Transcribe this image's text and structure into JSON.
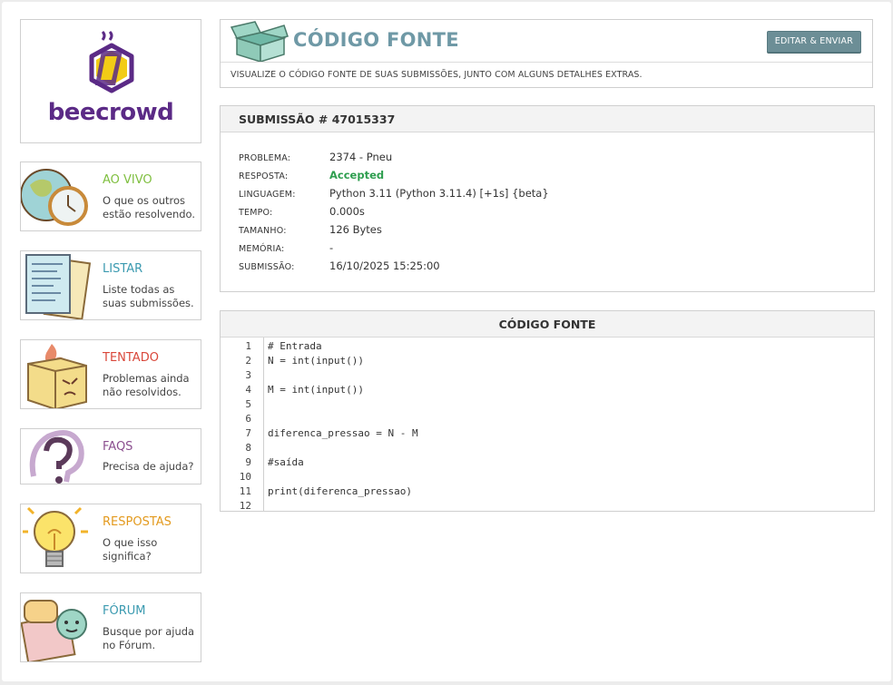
{
  "sidebar": {
    "logo_text": "beecrowd",
    "cards": [
      {
        "title": "AO VIVO",
        "desc": "O que os outros estão resolvendo.",
        "color": "#7fbf3f",
        "icon": "globe-clock-icon"
      },
      {
        "title": "LISTAR",
        "desc": "Liste todas as suas submissões.",
        "color": "#3b9ab0",
        "icon": "papers-icon"
      },
      {
        "title": "TENTADO",
        "desc": "Problemas ainda não resolvidos.",
        "color": "#d9473a",
        "icon": "angry-box-icon"
      },
      {
        "title": "FAQS",
        "desc": "Precisa de ajuda?",
        "color": "#8b4f8f",
        "icon": "question-mark-icon"
      },
      {
        "title": "RESPOSTAS",
        "desc": "O que isso significa?",
        "color": "#e39a1e",
        "icon": "lightbulb-icon"
      },
      {
        "title": "FÓRUM",
        "desc": "Busque por ajuda no Fórum.",
        "color": "#3b9ab0",
        "icon": "speech-bubbles-icon"
      }
    ]
  },
  "header": {
    "title": "CÓDIGO FONTE",
    "edit_button": "EDITAR & ENVIAR",
    "subtitle": "VISUALIZE O CÓDIGO FONTE DE SUAS SUBMISSÕES, JUNTO COM ALGUNS DETALHES EXTRAS.",
    "icon": "open-box-icon"
  },
  "submission": {
    "heading": "SUBMISSÃO # 47015337",
    "fields": [
      {
        "key": "PROBLEMA:",
        "value": "2374 - Pneu"
      },
      {
        "key": "RESPOSTA:",
        "value": "Accepted"
      },
      {
        "key": "LINGUAGEM:",
        "value": "Python 3.11 (Python 3.11.4) [+1s] {beta}"
      },
      {
        "key": "TEMPO:",
        "value": "0.000s"
      },
      {
        "key": "TAMANHO:",
        "value": "126 Bytes"
      },
      {
        "key": "MEMÓRIA:",
        "value": "-"
      },
      {
        "key": "SUBMISSÃO:",
        "value": "16/10/2025 15:25:00"
      }
    ],
    "accepted_color": "#2e9e4f"
  },
  "code": {
    "heading": "CÓDIGO FONTE",
    "lines": [
      {
        "n": "1",
        "text": "# Entrada"
      },
      {
        "n": "2",
        "text": "N = int(input())"
      },
      {
        "n": "3",
        "text": ""
      },
      {
        "n": "4",
        "text": "M = int(input())"
      },
      {
        "n": "5",
        "text": ""
      },
      {
        "n": "6",
        "text": ""
      },
      {
        "n": "7",
        "text": "diferenca_pressao = N - M"
      },
      {
        "n": "8",
        "text": ""
      },
      {
        "n": "9",
        "text": "#saída"
      },
      {
        "n": "10",
        "text": ""
      },
      {
        "n": "11",
        "text": "print(diferenca_pressao)"
      },
      {
        "n": "12",
        "text": ""
      }
    ]
  }
}
